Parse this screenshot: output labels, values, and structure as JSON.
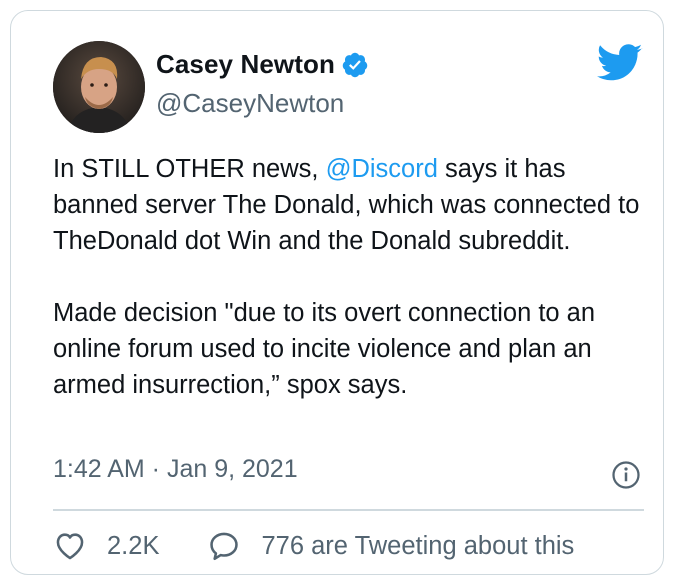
{
  "author": {
    "name": "Casey Newton",
    "handle": "@CaseyNewton",
    "verified": true
  },
  "tweet": {
    "paragraph1": {
      "prefix": "In STILL OTHER news, ",
      "mention": "@Discord",
      "suffix": " says it has banned server The Donald, which was connected to TheDonald dot Win and the Donald subreddit."
    },
    "paragraph2": "Made decision \"due to its overt connection to an online forum used to incite violence and plan an armed insurrection,” spox says.",
    "timestamp": "1:42 AM · Jan 9, 2021"
  },
  "actions": {
    "likes": "2.2K",
    "tweeting": "776 are Tweeting about this"
  },
  "icons": {
    "logo": "twitter-bird-icon",
    "verified": "verified-badge-icon",
    "info": "info-icon",
    "like": "heart-icon",
    "reply": "comment-icon"
  },
  "colors": {
    "accent": "#1d9bf0",
    "text": "#0f1419",
    "secondary": "#536471",
    "border": "#cfd9de"
  }
}
